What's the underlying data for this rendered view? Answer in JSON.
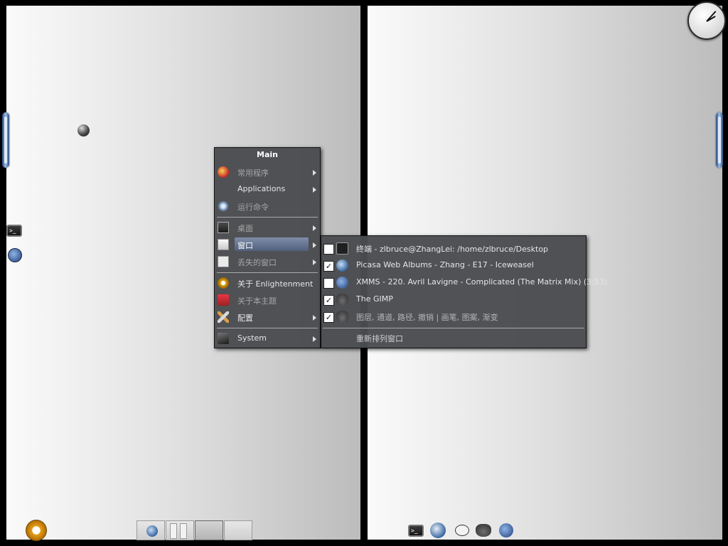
{
  "desktop": {
    "clock": {
      "hour": 2,
      "minute": 7
    }
  },
  "main_menu": {
    "title": "Main",
    "items": [
      {
        "label": "常用程序",
        "icon": "favorites-icon",
        "submenu": true,
        "dim": true
      },
      {
        "label": "Applications",
        "icon": "none",
        "submenu": true,
        "dim": false
      },
      {
        "label": "运行命令",
        "icon": "run-command-icon",
        "submenu": false,
        "dim": true
      },
      {
        "label": "桌面",
        "icon": "monitor-icon",
        "submenu": true,
        "dim": true
      },
      {
        "label": "窗口",
        "icon": "window-icon",
        "submenu": true,
        "dim": true,
        "selected": true
      },
      {
        "label": "丢失的窗口",
        "icon": "magnifier-icon",
        "submenu": true,
        "dim": true
      },
      {
        "label": "关于 Enlightenment",
        "icon": "enlightenment-icon",
        "submenu": false,
        "dim": false
      },
      {
        "label": "关于本主题",
        "icon": "theme-icon",
        "submenu": false,
        "dim": true
      },
      {
        "label": "配置",
        "icon": "tools-icon",
        "submenu": true,
        "dim": false
      },
      {
        "label": "System",
        "icon": "laptop-icon",
        "submenu": true,
        "dim": false
      }
    ]
  },
  "windows_menu": {
    "items": [
      {
        "title": "终端  - zlbruce@ZhangLei: /home/zlbruce/Desktop",
        "icon": "terminal-icon",
        "checked": false,
        "dim": false
      },
      {
        "title": "Picasa Web Albums - Zhang - E17 - Iceweasel",
        "icon": "iceweasel-icon",
        "checked": true,
        "dim": false
      },
      {
        "title": "XMMS - 220. Avril Lavigne - Complicated (The Matrix Mix) (3:53)",
        "icon": "xmms-icon",
        "checked": false,
        "dim": false
      },
      {
        "title": "The GIMP",
        "icon": "gimp-icon",
        "checked": true,
        "dim": false
      },
      {
        "title": "图层, 通道, 路径, 撤销 | 画笔, 图案, 渐变",
        "icon": "gimp-icon",
        "checked": true,
        "dim": true
      }
    ],
    "footer": "重新排列窗口"
  },
  "shelf": {
    "start_icon": "enlightenment-start-icon",
    "pager_desks": 4,
    "taskbar_icons": [
      "terminal-icon",
      "iceweasel-icon",
      "xchat-icon",
      "gimp-icon",
      "xmms-icon"
    ]
  },
  "colors": {
    "menu_bg": "#4a4c50",
    "menu_highlight": "#6b7a96",
    "handle_blue": "#7ea6de"
  }
}
